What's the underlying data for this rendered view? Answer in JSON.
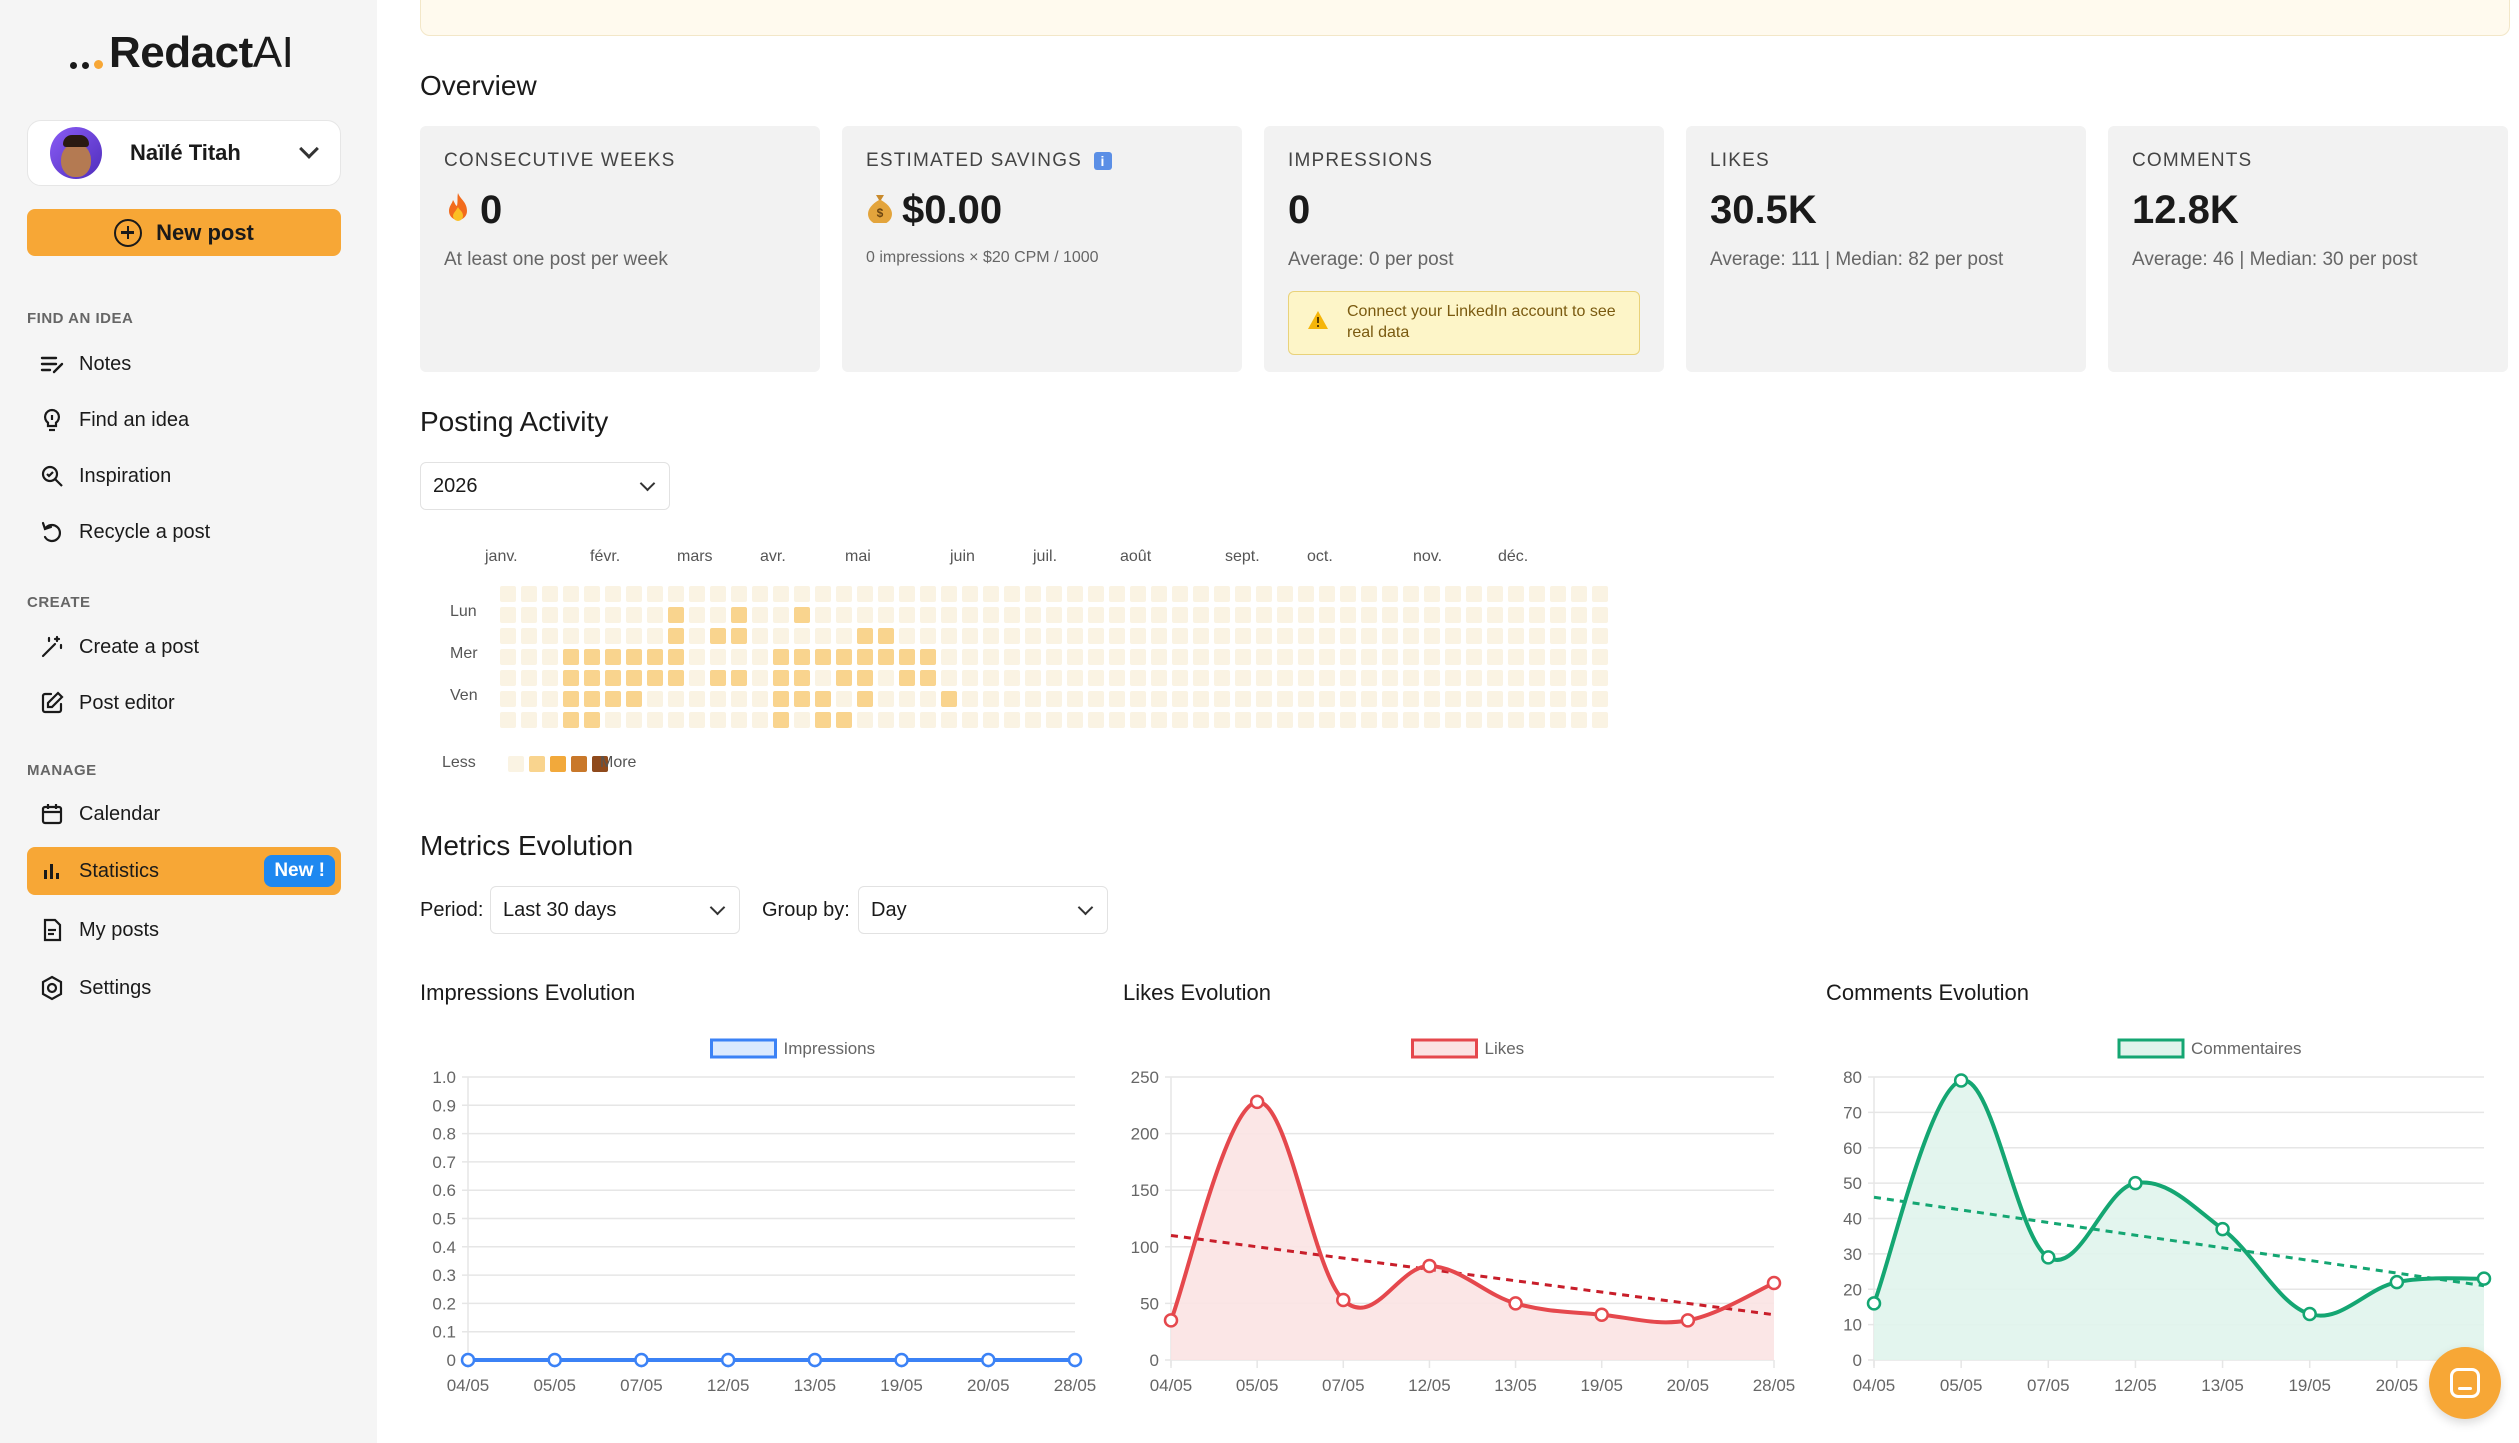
{
  "app": {
    "logo_main": "Redact",
    "logo_ai": "AI"
  },
  "user": {
    "name": "Naïlé Titah"
  },
  "sidebar": {
    "new_post": "New post",
    "sections": {
      "find": "FIND AN IDEA",
      "create": "CREATE",
      "manage": "MANAGE"
    },
    "items": [
      {
        "label": "Notes",
        "icon": "notes-icon"
      },
      {
        "label": "Find an idea",
        "icon": "lightbulb-icon"
      },
      {
        "label": "Inspiration",
        "icon": "search-spark-icon"
      },
      {
        "label": "Recycle a post",
        "icon": "recycle-icon"
      },
      {
        "label": "Create a post",
        "icon": "magic-wand-icon"
      },
      {
        "label": "Post editor",
        "icon": "edit-icon"
      },
      {
        "label": "Calendar",
        "icon": "calendar-icon"
      },
      {
        "label": "Statistics",
        "icon": "bar-chart-icon",
        "active": true,
        "badge": "New !"
      },
      {
        "label": "My posts",
        "icon": "document-icon"
      },
      {
        "label": "Settings",
        "icon": "gear-icon"
      }
    ]
  },
  "overview": {
    "title": "Overview",
    "cards": [
      {
        "label": "CONSECUTIVE WEEKS",
        "value": "0",
        "icon": "fire-icon",
        "sub": "At least one post per week"
      },
      {
        "label": "ESTIMATED SAVINGS",
        "value": "$0.00",
        "icon": "money-bag-icon",
        "sub": "0 impressions × $20 CPM / 1000"
      },
      {
        "label": "IMPRESSIONS",
        "value": "0",
        "sub": "Average: 0 per post",
        "warning": "Connect your LinkedIn account to see real data"
      },
      {
        "label": "LIKES",
        "value": "30.5K",
        "sub": "Average: 111 | Median: 82 per post"
      },
      {
        "label": "COMMENTS",
        "value": "12.8K",
        "sub": "Average: 46 | Median: 30 per post"
      }
    ]
  },
  "posting_activity": {
    "title": "Posting Activity",
    "year": "2026",
    "months": [
      "janv.",
      "févr.",
      "mars",
      "avr.",
      "mai",
      "juin",
      "juil.",
      "août",
      "sept.",
      "oct.",
      "nov.",
      "déc."
    ],
    "days": [
      "Lun",
      "Mer",
      "Ven"
    ],
    "legend_less": "Less",
    "legend_more": "More",
    "colors": [
      "#faf3e3",
      "#f9d48e",
      "#f2a93b",
      "#c9782a",
      "#8f4a1c"
    ]
  },
  "metrics": {
    "title": "Metrics Evolution",
    "period_label": "Period:",
    "period_value": "Last 30 days",
    "group_label": "Group by:",
    "group_value": "Day"
  },
  "chart_data": [
    {
      "type": "line",
      "title": "Impressions Evolution",
      "series": [
        {
          "name": "Impressions",
          "values": [
            0,
            0,
            0,
            0,
            0,
            0,
            0,
            0
          ]
        }
      ],
      "x": [
        "04/05",
        "05/05",
        "07/05",
        "12/05",
        "13/05",
        "19/05",
        "20/05",
        "28/05"
      ],
      "ylim": [
        0,
        1.0
      ],
      "yticks": [
        "0",
        "0.1",
        "0.2",
        "0.3",
        "0.4",
        "0.5",
        "0.6",
        "0.7",
        "0.8",
        "0.9",
        "1.0"
      ],
      "color": "#3b82f6",
      "fill": "#dbeafe",
      "grid": true,
      "legend": "top-center"
    },
    {
      "type": "area",
      "title": "Likes Evolution",
      "series": [
        {
          "name": "Likes",
          "values": [
            35,
            228,
            53,
            83,
            50,
            40,
            35,
            68
          ]
        }
      ],
      "trend": [
        110,
        40
      ],
      "x": [
        "04/05",
        "05/05",
        "07/05",
        "12/05",
        "13/05",
        "19/05",
        "20/05",
        "28/05"
      ],
      "ylim": [
        0,
        250
      ],
      "yticks": [
        "0",
        "50",
        "100",
        "150",
        "200",
        "250"
      ],
      "color": "#e5484d",
      "fill": "#fbe3e3",
      "grid": true,
      "legend": "top-center"
    },
    {
      "type": "area",
      "title": "Comments Evolution",
      "series": [
        {
          "name": "Commentaires",
          "values": [
            16,
            79,
            29,
            50,
            37,
            13,
            22,
            23
          ]
        }
      ],
      "trend": [
        46,
        21
      ],
      "x": [
        "04/05",
        "05/05",
        "07/05",
        "12/05",
        "13/05",
        "19/05",
        "20/05",
        "28/05"
      ],
      "ylim": [
        0,
        80
      ],
      "yticks": [
        "0",
        "10",
        "20",
        "30",
        "40",
        "50",
        "60",
        "70",
        "80"
      ],
      "color": "#14a672",
      "fill": "#e0f4ec",
      "grid": true,
      "legend": "top-center"
    }
  ]
}
